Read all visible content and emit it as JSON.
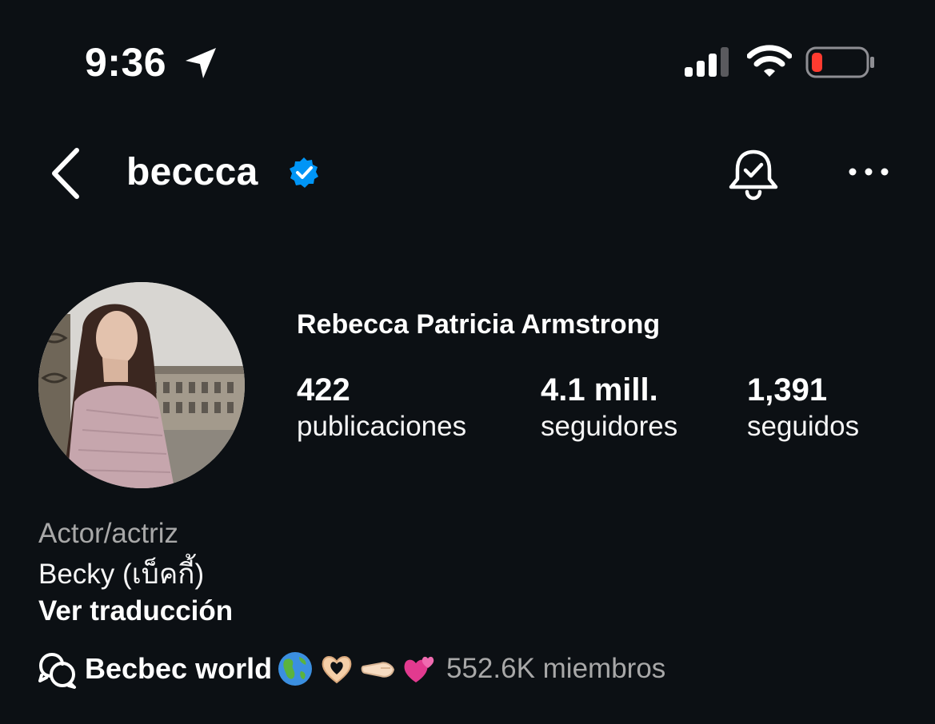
{
  "status_bar": {
    "time": "9:36",
    "icons": [
      "location-arrow-icon",
      "signal-icon",
      "wifi-icon",
      "battery-low-icon"
    ],
    "battery_color": "#ff3b30"
  },
  "header": {
    "username": "beccca",
    "verified_color": "#0095f6",
    "icons": [
      "back-chevron-icon",
      "verified-badge-icon",
      "bell-check-icon",
      "more-dots-icon"
    ]
  },
  "profile": {
    "full_name": "Rebecca Patricia Armstrong",
    "stats": {
      "posts_value": "422",
      "posts_label": "publicaciones",
      "followers_value": "4.1 mill.",
      "followers_label": "seguidores",
      "following_value": "1,391",
      "following_label": "seguidos"
    },
    "category": "Actor/actriz",
    "bio": "Becky (เบ็คกี้)",
    "translate_label": "Ver traducción"
  },
  "channel": {
    "name": "Becbec world",
    "emojis": [
      "globe-americas-icon",
      "heart-hands-icon",
      "pinched-hand-icon",
      "two-hearts-icon"
    ],
    "members": "552.6K miembros"
  },
  "colors": {
    "background": "#0c1014",
    "text_primary": "#f5f5f5",
    "text_secondary": "#a8a8a8"
  }
}
